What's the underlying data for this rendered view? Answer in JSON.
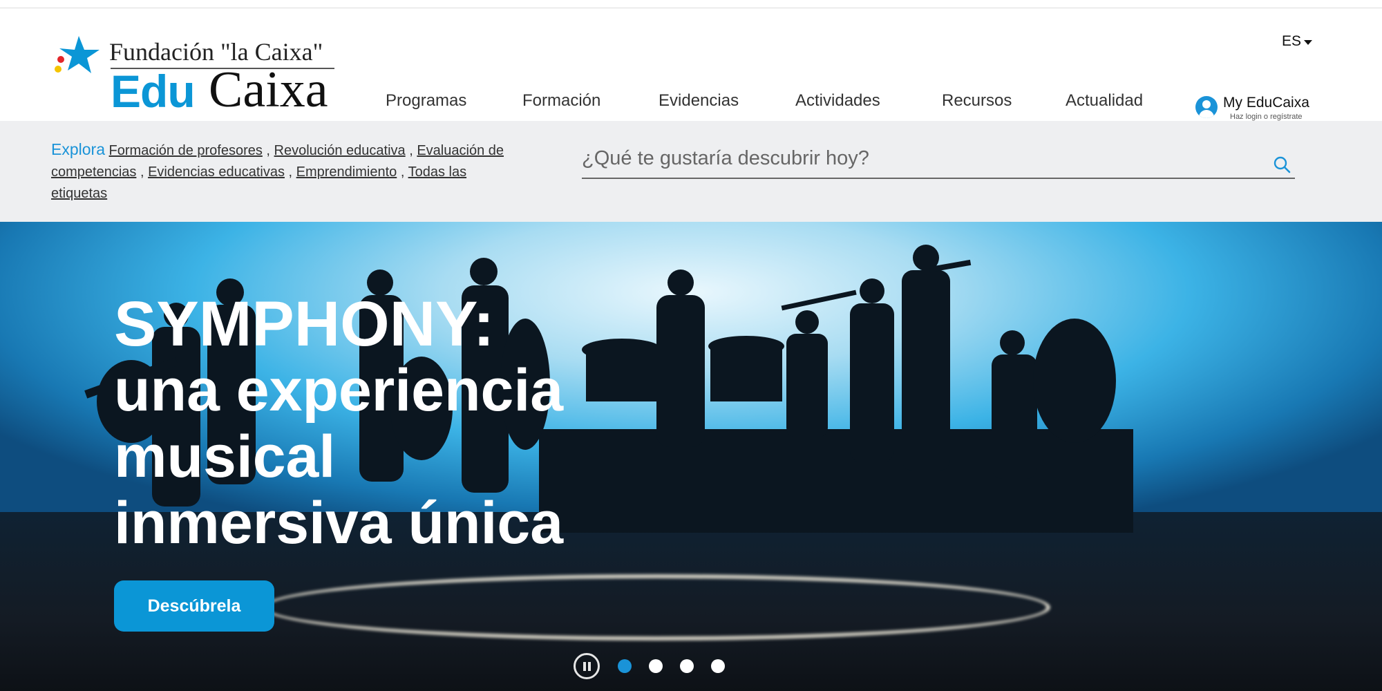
{
  "brand": {
    "foundation": "Fundación \"la Caixa\"",
    "edu": "Edu",
    "caixa": "Caixa"
  },
  "language": {
    "label": "ES"
  },
  "nav": {
    "items": [
      "Programas",
      "Formación",
      "Evidencias",
      "Actividades",
      "Recursos",
      "Actualidad"
    ]
  },
  "account": {
    "title": "My EduCaixa",
    "subtitle": "Haz login o regístrate"
  },
  "explore": {
    "label": "Explora",
    "tags": [
      "Formación de profesores",
      "Revolución educativa",
      "Evaluación de competencias",
      "Evidencias educativas",
      "Emprendimiento",
      "Todas las etiquetas"
    ],
    "separator": " , "
  },
  "search": {
    "placeholder": "¿Qué te gustaría descubrir hoy?"
  },
  "hero": {
    "title_lines": [
      "SYMPHONY:",
      "una experiencia",
      "musical",
      "inmersiva única"
    ],
    "cta_label": "Descúbrela",
    "slides_total": 4,
    "active_slide": 1
  },
  "colors": {
    "accent": "#0b96d6",
    "explore_bg": "#eeeff1"
  },
  "icons": [
    "caixa-star-icon",
    "chevron-down-icon",
    "user-icon",
    "search-icon",
    "pause-icon"
  ]
}
